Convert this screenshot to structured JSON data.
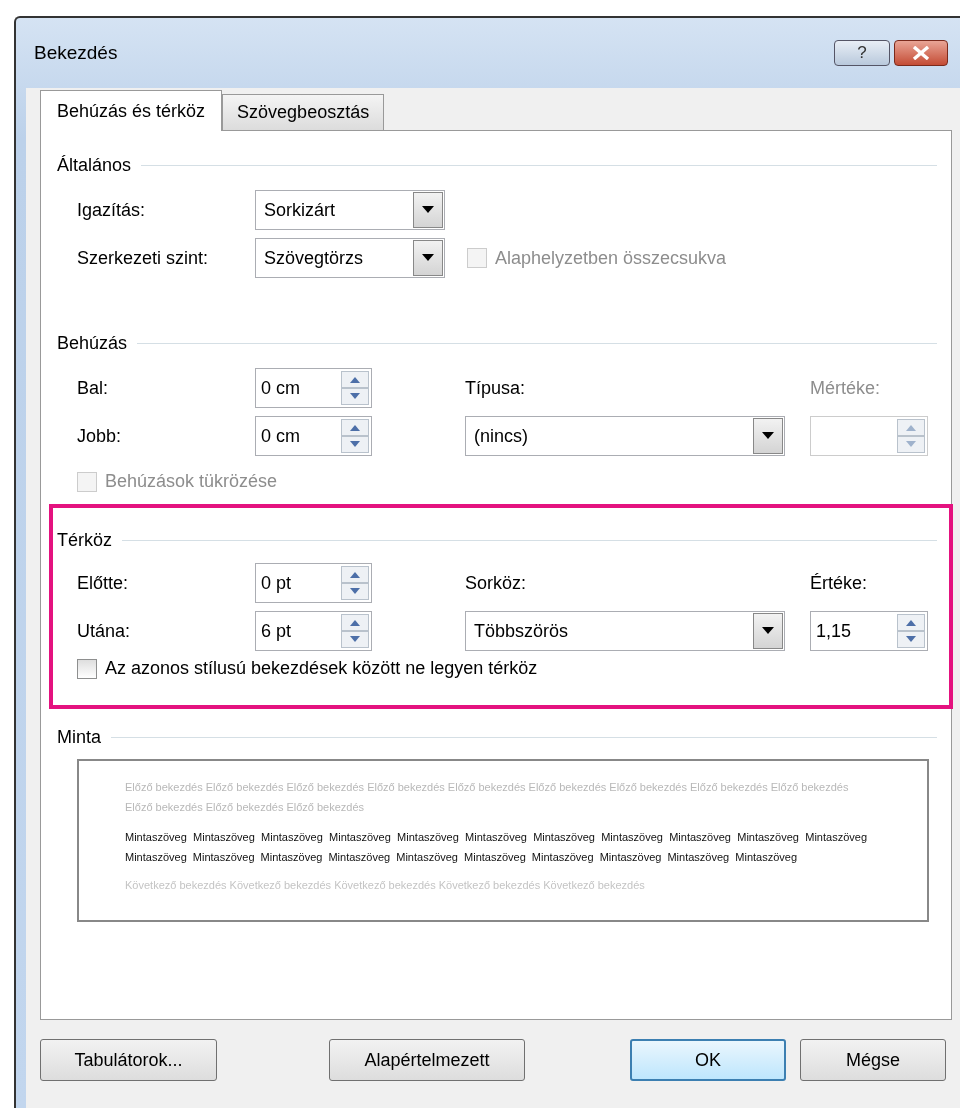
{
  "window": {
    "title": "Bekezdés"
  },
  "title_buttons": [
    {
      "kind": "help",
      "label": "?"
    },
    {
      "kind": "close"
    }
  ],
  "tabs": [
    {
      "label": "Behúzás és térköz",
      "selected": true
    },
    {
      "label": "Szövegbeosztás",
      "selected": false
    }
  ],
  "general": {
    "title": "Általános",
    "alignment": {
      "label": "Igazítás:",
      "value": "Sorkizárt"
    },
    "outline_level": {
      "label": "Szerkezeti szint:",
      "value": "Szövegtörzs"
    },
    "collapsed": {
      "label": "Alaphelyzetben összecsukva",
      "checked": false,
      "disabled": true
    }
  },
  "indentation": {
    "title": "Behúzás",
    "left": {
      "label": "Bal:",
      "value": "0 cm"
    },
    "right": {
      "label": "Jobb:",
      "value": "0 cm"
    },
    "special": {
      "label": "Típusa:",
      "value": "(nincs)"
    },
    "by": {
      "label": "Mértéke:",
      "disabled": true
    },
    "mirror": {
      "label": "Behúzások tükrözése",
      "checked": false,
      "disabled": true
    }
  },
  "spacing": {
    "title": "Térköz",
    "highlighted": true,
    "before": {
      "label": "Előtte:",
      "value": "0 pt"
    },
    "after": {
      "label": "Utána:",
      "value": "6 pt"
    },
    "line_spacing": {
      "label": "Sorköz:",
      "value": "Többszörös"
    },
    "at": {
      "label": "Értéke:",
      "value": "1,15"
    },
    "dont_add": {
      "label": "Az azonos stílusú bekezdések között ne legyen térköz",
      "checked": false,
      "disabled": false
    }
  },
  "preview": {
    "title": "Minta",
    "previous": "Előző bekezdés Előző bekezdés Előző bekezdés Előző bekezdés Előző bekezdés Előző bekezdés Előző bekezdés Előző bekezdés Előző bekezdés Előző bekezdés Előző bekezdés Előző bekezdés",
    "sample": "Mintaszöveg Mintaszöveg Mintaszöveg Mintaszöveg Mintaszöveg Mintaszöveg Mintaszöveg Mintaszöveg Mintaszöveg Mintaszöveg Mintaszöveg Mintaszöveg Mintaszöveg Mintaszöveg Mintaszöveg Mintaszöveg Mintaszöveg Mintaszöveg Mintaszöveg Mintaszöveg Mintaszöveg",
    "next": "Következő bekezdés Következő bekezdés Következő bekezdés Következő bekezdés Következő bekezdés"
  },
  "buttons": [
    {
      "label": "Tabulátorok...",
      "default": false
    },
    {
      "label": "Alapértelmezett",
      "default": false
    },
    {
      "label": "OK",
      "default": true
    },
    {
      "label": "Mégse",
      "default": false
    }
  ]
}
